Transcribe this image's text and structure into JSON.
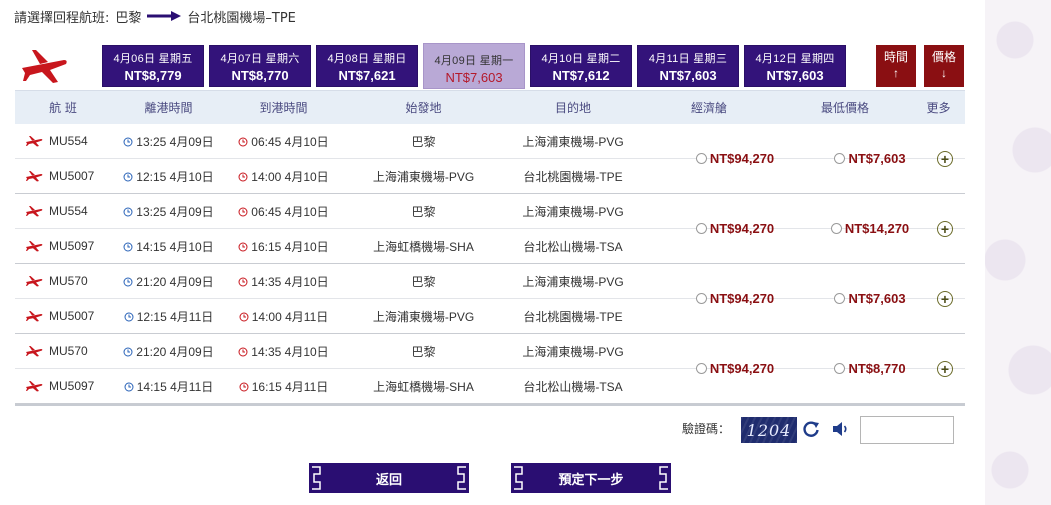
{
  "header": {
    "prompt": "請選擇回程航班:",
    "origin": "巴黎",
    "destination": "台北桃園機場–TPE"
  },
  "date_tabs": [
    {
      "date": "4月06日 星期五",
      "price": "NT$8,779",
      "active": false
    },
    {
      "date": "4月07日 星期六",
      "price": "NT$8,770",
      "active": false
    },
    {
      "date": "4月08日 星期日",
      "price": "NT$7,621",
      "active": false
    },
    {
      "date": "4月09日 星期一",
      "price": "NT$7,603",
      "active": true
    },
    {
      "date": "4月10日 星期二",
      "price": "NT$7,612",
      "active": false
    },
    {
      "date": "4月11日 星期三",
      "price": "NT$7,603",
      "active": false
    },
    {
      "date": "4月12日 星期四",
      "price": "NT$7,603",
      "active": false
    }
  ],
  "sort": {
    "time_label": "時間",
    "time_arrow": "↑",
    "price_label": "價格",
    "price_arrow": "↓"
  },
  "columns": {
    "flight": "航 班",
    "departure": "離港時間",
    "arrival": "到港時間",
    "from": "始發地",
    "to": "目的地",
    "economy": "經濟艙",
    "lowest": "最低價格",
    "more": "更多"
  },
  "options": [
    {
      "economy": "NT$94,270",
      "lowest": "NT$7,603",
      "legs": [
        {
          "flight": "MU554",
          "dep": "13:25 4月09日",
          "arr": "06:45 4月10日",
          "from": "巴黎",
          "to": "上海浦東機場-PVG"
        },
        {
          "flight": "MU5007",
          "dep": "12:15 4月10日",
          "arr": "14:00 4月10日",
          "from": "上海浦東機場-PVG",
          "to": "台北桃園機場-TPE"
        }
      ]
    },
    {
      "economy": "NT$94,270",
      "lowest": "NT$14,270",
      "legs": [
        {
          "flight": "MU554",
          "dep": "13:25 4月09日",
          "arr": "06:45 4月10日",
          "from": "巴黎",
          "to": "上海浦東機場-PVG"
        },
        {
          "flight": "MU5097",
          "dep": "14:15 4月10日",
          "arr": "16:15 4月10日",
          "from": "上海虹橋機場-SHA",
          "to": "台北松山機場-TSA"
        }
      ]
    },
    {
      "economy": "NT$94,270",
      "lowest": "NT$7,603",
      "legs": [
        {
          "flight": "MU570",
          "dep": "21:20 4月09日",
          "arr": "14:35 4月10日",
          "from": "巴黎",
          "to": "上海浦東機場-PVG"
        },
        {
          "flight": "MU5007",
          "dep": "12:15 4月11日",
          "arr": "14:00 4月11日",
          "from": "上海浦東機場-PVG",
          "to": "台北桃園機場-TPE"
        }
      ]
    },
    {
      "economy": "NT$94,270",
      "lowest": "NT$8,770",
      "legs": [
        {
          "flight": "MU570",
          "dep": "21:20 4月09日",
          "arr": "14:35 4月10日",
          "from": "巴黎",
          "to": "上海浦東機場-PVG"
        },
        {
          "flight": "MU5097",
          "dep": "14:15 4月11日",
          "arr": "16:15 4月11日",
          "from": "上海虹橋機場-SHA",
          "to": "台北松山機場-TSA"
        }
      ]
    }
  ],
  "captcha": {
    "label": "驗證碼：",
    "code": "1204",
    "input_value": ""
  },
  "buttons": {
    "back": "返回",
    "next": "預定下一步"
  },
  "colors": {
    "brand_purple": "#33137a",
    "active_tab": "#b9a9d6",
    "sort_red": "#8a0f12",
    "price_red": "#8a0f12",
    "header_bg": "#e7eef6"
  }
}
